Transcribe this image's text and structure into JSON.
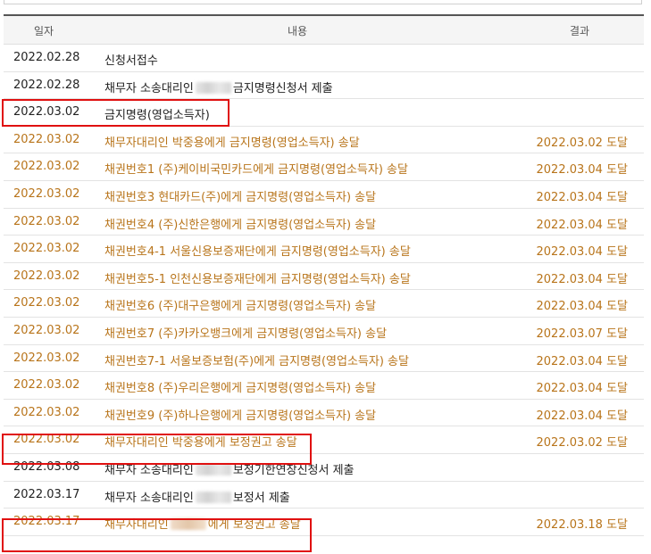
{
  "header": {
    "date": "일자",
    "content": "내용",
    "result": "결과"
  },
  "accent_color": "#e01010",
  "orange_text_color": "#b8741a",
  "rows": [
    {
      "date": "2022.02.28",
      "content": "신청서접수",
      "result": ""
    },
    {
      "date": "2022.02.28",
      "content_before": "채무자 소송대리인",
      "content_after": "금지명령신청서 제출",
      "result": ""
    },
    {
      "date": "2022.03.02",
      "content": "금지명령(영업소득자)",
      "result": ""
    },
    {
      "date": "2022.03.02",
      "content": "채무자대리인 박중용에게 금지명령(영업소득자) 송달",
      "result": "2022.03.02 도달"
    },
    {
      "date": "2022.03.02",
      "content": "채권번호1 (주)케이비국민카드에게 금지명령(영업소득자) 송달",
      "result": "2022.03.04 도달"
    },
    {
      "date": "2022.03.02",
      "content": "채권번호3 현대카드(주)에게 금지명령(영업소득자) 송달",
      "result": "2022.03.04 도달"
    },
    {
      "date": "2022.03.02",
      "content": "채권번호4 (주)신한은행에게 금지명령(영업소득자) 송달",
      "result": "2022.03.04 도달"
    },
    {
      "date": "2022.03.02",
      "content": "채권번호4-1 서울신용보증재단에게 금지명령(영업소득자) 송달",
      "result": "2022.03.04 도달"
    },
    {
      "date": "2022.03.02",
      "content": "채권번호5-1 인천신용보증재단에게 금지명령(영업소득자) 송달",
      "result": "2022.03.04 도달"
    },
    {
      "date": "2022.03.02",
      "content": "채권번호6 (주)대구은행에게 금지명령(영업소득자) 송달",
      "result": "2022.03.04 도달"
    },
    {
      "date": "2022.03.02",
      "content": "채권번호7 (주)카카오뱅크에게 금지명령(영업소득자) 송달",
      "result": "2022.03.07 도달"
    },
    {
      "date": "2022.03.02",
      "content": "채권번호7-1 서울보증보험(주)에게 금지명령(영업소득자) 송달",
      "result": "2022.03.04 도달"
    },
    {
      "date": "2022.03.02",
      "content": "채권번호8 (주)우리은행에게 금지명령(영업소득자) 송달",
      "result": "2022.03.04 도달"
    },
    {
      "date": "2022.03.02",
      "content": "채권번호9 (주)하나은행에게 금지명령(영업소득자) 송달",
      "result": "2022.03.04 도달"
    },
    {
      "date": "2022.03.02",
      "content": "채무자대리인 박중용에게 보정권고 송달",
      "result": "2022.03.02 도달"
    },
    {
      "date": "2022.03.08",
      "content_before": "채무자 소송대리인",
      "content_after": "보정기한연장신청서 제출",
      "result": ""
    },
    {
      "date": "2022.03.17",
      "content_before": "채무자 소송대리인",
      "content_after": "보정서 제출",
      "result": ""
    },
    {
      "date": "2022.03.17",
      "content_before": "채무자대리인",
      "content_after": "에게 보정권고 송달",
      "result": "2022.03.18 도달"
    }
  ]
}
